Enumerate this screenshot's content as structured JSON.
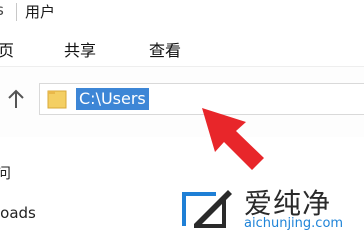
{
  "window": {
    "title_edge": "s",
    "title": "用户"
  },
  "ribbon": {
    "tabs": [
      "页",
      "共享",
      "查看"
    ]
  },
  "address_bar": {
    "path": "C:\\Users"
  },
  "sidebar": {
    "items": [
      "问",
      "loads"
    ]
  },
  "watermark": {
    "name": "爱纯净",
    "url": "aichunjing.com"
  },
  "colors": {
    "selection": "#3d86d6",
    "arrow": "#e8262a",
    "folder": "#f4cf63",
    "watermark_url": "#1f84d8"
  }
}
